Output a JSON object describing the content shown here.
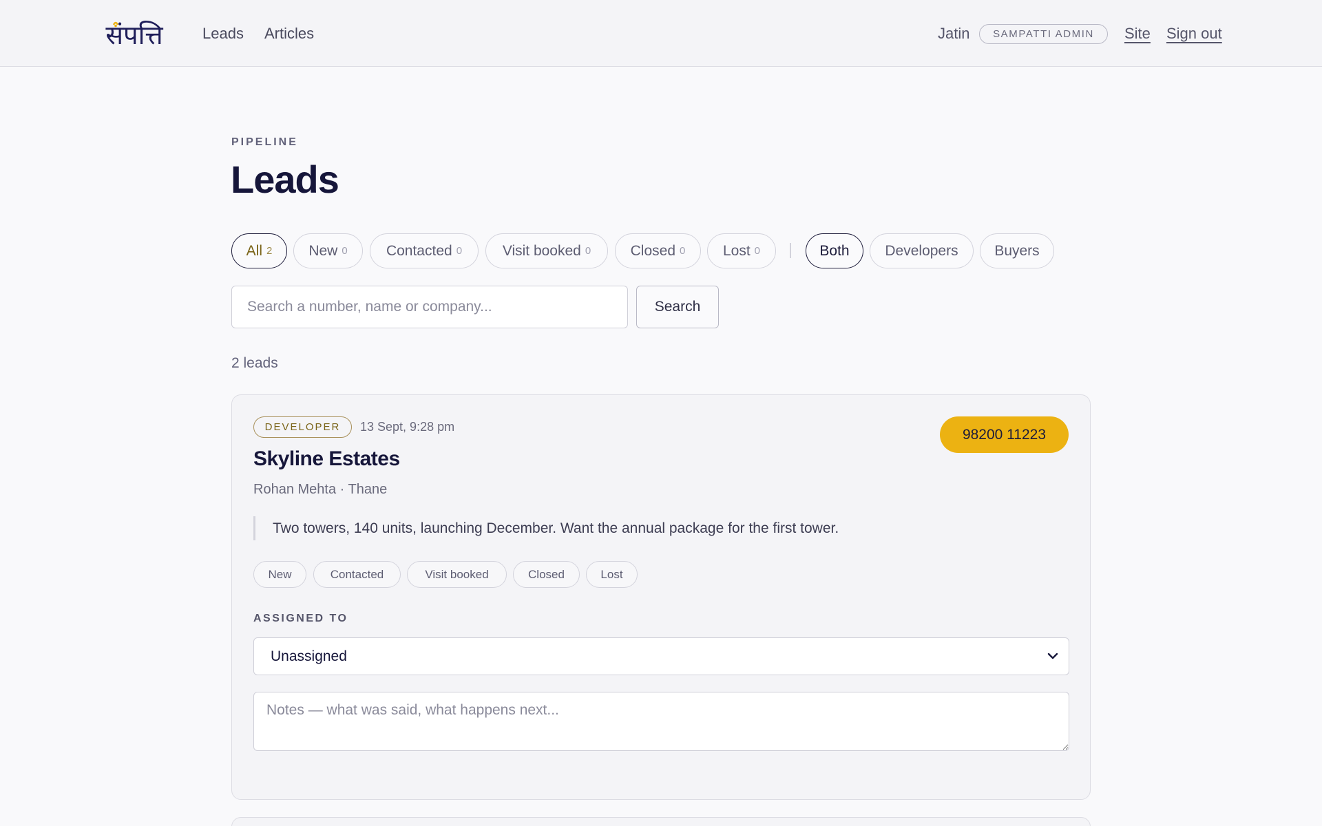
{
  "header": {
    "logo_text": "संपत्ति",
    "nav": [
      "Leads",
      "Articles"
    ],
    "user_name": "Jatin",
    "role_badge": "SAMPATTI ADMIN",
    "site_link": "Site",
    "signout_link": "Sign out",
    "brand_color": "#1f1e5a",
    "accent_color": "#ecb212"
  },
  "page": {
    "eyebrow": "PIPELINE",
    "title": "Leads"
  },
  "status_filters": [
    {
      "label": "All",
      "count": "2",
      "active": true
    },
    {
      "label": "New",
      "count": "0",
      "active": false
    },
    {
      "label": "Contacted",
      "count": "0",
      "active": false
    },
    {
      "label": "Visit booked",
      "count": "0",
      "active": false
    },
    {
      "label": "Closed",
      "count": "0",
      "active": false
    },
    {
      "label": "Lost",
      "count": "0",
      "active": false
    }
  ],
  "audience_filters": [
    {
      "label": "Both",
      "active": true
    },
    {
      "label": "Developers",
      "active": false
    },
    {
      "label": "Buyers",
      "active": false
    }
  ],
  "search": {
    "placeholder": "Search a number, name or company...",
    "value": "",
    "button_label": "Search"
  },
  "results": {
    "count_text": "2 leads"
  },
  "leads": [
    {
      "type": "DEVELOPER",
      "date": "13 Sept, 9:28 pm",
      "phone": "98200 11223",
      "company": "Skyline Estates",
      "meta": "Rohan Mehta · Thane",
      "message": "Two towers, 140 units, launching December. Want the annual package for the first tower.",
      "status_options": [
        "New",
        "Contacted",
        "Visit booked",
        "Closed",
        "Lost"
      ],
      "assigned_label": "ASSIGNED TO",
      "assigned_value": "Unassigned",
      "notes_placeholder": "Notes — what was said, what happens next...",
      "notes_value": ""
    }
  ]
}
